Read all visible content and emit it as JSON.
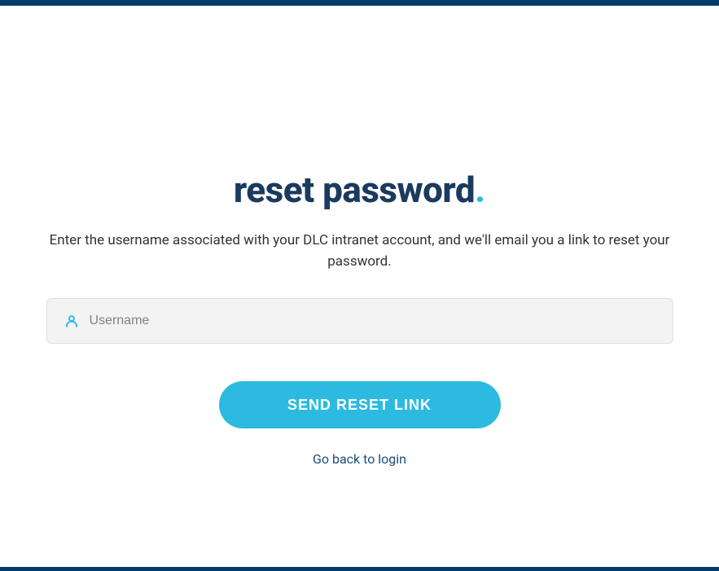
{
  "page": {
    "title": "reset password",
    "titleDot": ".",
    "subtitle": "Enter the username associated with your DLC intranet account, and we'll email you a link to reset your password."
  },
  "form": {
    "usernamePlaceholder": "Username",
    "usernameValue": "",
    "submitLabel": "SEND RESET LINK"
  },
  "links": {
    "backToLogin": "Go back to login"
  },
  "colors": {
    "primary": "#1b3a5e",
    "accent": "#2cbae0",
    "topBar": "#003a6b"
  }
}
